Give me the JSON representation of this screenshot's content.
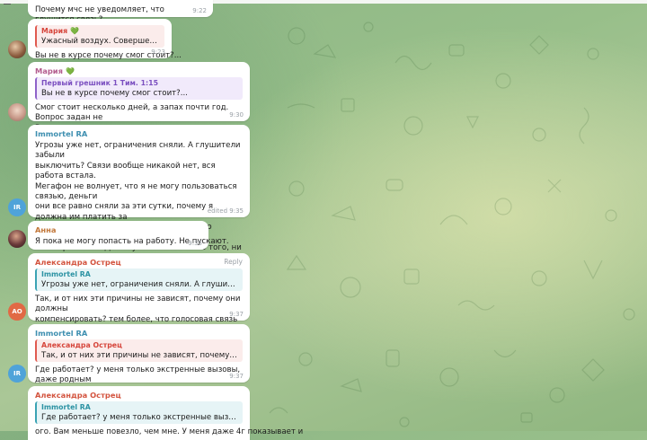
{
  "messages": [
    {
      "text": "Почему мчс не уведомляет, что глушится связь?",
      "time": "9:22"
    },
    {
      "quote_name": "Мария",
      "quote_text": "Ужасный воздух. Совершенно нече...",
      "text": "Вы не в курсе почему смог стоит?...",
      "time": "9:23",
      "avatar_label": "avatar"
    },
    {
      "sender": "Мария",
      "quote_name": "Первый грешник 1 Тим. 1:15",
      "quote_text": "Вы не в курсе почему смог стоит?...",
      "text": "Смог стоит несколько дней, а запах почти год. Вопрос задан не\nВам.",
      "time": "9:30"
    },
    {
      "sender": "Immortel RA",
      "text": "Угрозы уже нет, ограничения сняли. А глушители забыли\nвыключить? Связи вообще никакой нет, вся работа встала.\nМегафон не волнует, что я не могу пользоваться связью, деньги\nони все равно сняли за эти сутки, почему я должна им платить за\nуслуги, которыми не могу пользоваться по независящим от\nменя причинам? Дайте уже связь. И мало того, ни оплатить\nкартой, ни снять деньги с нее (наличные) нельзя. А вы всё за\nцифровизацию топите, и вот нет связи и все встало...",
      "time": "edited 9:35",
      "avatar": "IR"
    },
    {
      "sender": "Анна",
      "text": "Я пока не могу попасть на работу. Не пускают.",
      "time": "9:35"
    },
    {
      "sender": "Александра Острец",
      "reply": "Reply",
      "quote_name": "Immortel RA",
      "quote_text": "Угрозы уже нет, ограничения сняли. А глушители забыли вы...",
      "text": "Так, и от них эти причины не зависят, почему они должны\nкомпенсировать? тем более, что голосовая связь работает,\nможно звонить и отправлять смс.",
      "time": "9:37",
      "avatar": "АО"
    },
    {
      "sender": "Immortel RA",
      "quote_name": "Александра Острец",
      "quote_text": "Так, и от них эти причины не зависят, почему они должны ко...",
      "text": "Где работает? у меня только экстренные вызовы, даже родным\nне позвонить, если что случится",
      "time": "9:37",
      "avatar": "IR"
    },
    {
      "sender": "Александра Острец",
      "quote_name": "Immortel RA",
      "quote_text": "Где работает? у меня только экстренные вызовы, даже родн...",
      "text": "ого. Вам меньше повезло, чем мне. У меня даже 4г показывает и"
    }
  ],
  "colors": {
    "immortel": "#3e8fb0",
    "anna": "#c2773a",
    "alexandra": "#d3543f",
    "maria": "#b35c8e",
    "ir_avatar": "#4fa3d9",
    "ao_avatar": "#e16a45"
  }
}
